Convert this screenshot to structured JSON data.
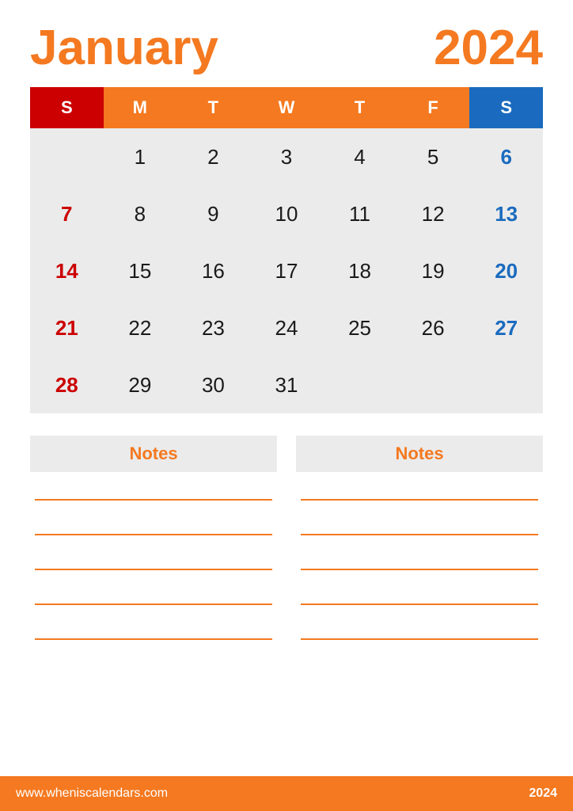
{
  "header": {
    "month": "January",
    "year": "2024"
  },
  "calendar": {
    "days_header": [
      {
        "label": "S",
        "type": "sun"
      },
      {
        "label": "M",
        "type": "normal"
      },
      {
        "label": "T",
        "type": "normal"
      },
      {
        "label": "W",
        "type": "normal"
      },
      {
        "label": "T",
        "type": "normal"
      },
      {
        "label": "F",
        "type": "normal"
      },
      {
        "label": "S",
        "type": "sat"
      }
    ],
    "weeks": [
      [
        "",
        "1",
        "2",
        "3",
        "4",
        "5",
        "6"
      ],
      [
        "7",
        "8",
        "9",
        "10",
        "11",
        "12",
        "13"
      ],
      [
        "14",
        "15",
        "16",
        "17",
        "18",
        "19",
        "20"
      ],
      [
        "21",
        "22",
        "23",
        "24",
        "25",
        "26",
        "27"
      ],
      [
        "28",
        "29",
        "30",
        "31",
        "",
        "",
        ""
      ]
    ]
  },
  "notes": [
    {
      "label": "Notes"
    },
    {
      "label": "Notes"
    }
  ],
  "footer": {
    "url": "www.wheniscalendars.com",
    "year": "2024"
  },
  "colors": {
    "orange": "#F47920",
    "red": "#cc0000",
    "blue": "#1a6bbf",
    "bg_light": "#ebebeb",
    "white": "#ffffff"
  }
}
